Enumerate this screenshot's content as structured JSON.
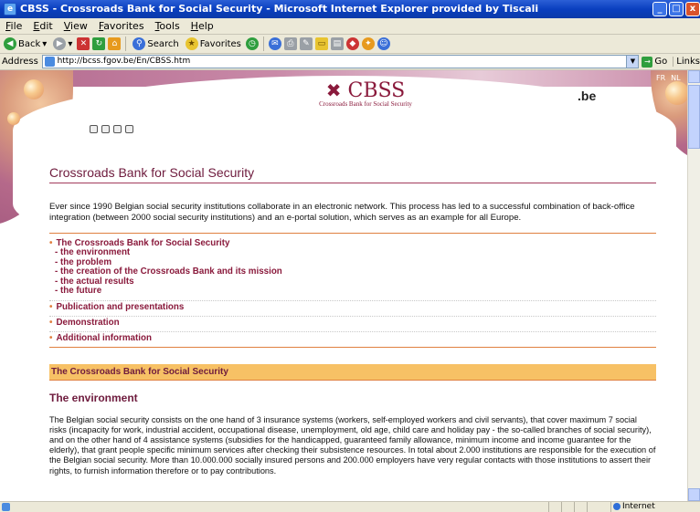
{
  "window": {
    "title": "CBSS - Crossroads Bank for Social Security - Microsoft Internet Explorer provided by Tiscali",
    "buttons": [
      "_",
      "□",
      "x"
    ]
  },
  "menu": [
    "File",
    "Edit",
    "View",
    "Favorites",
    "Tools",
    "Help"
  ],
  "toolbar": {
    "back": "Back",
    "search": "Search",
    "favorites": "Favorites"
  },
  "address": {
    "label": "Address",
    "url": "http://bcss.fgov.be/En/CBSS.htm",
    "go": "Go",
    "links": "Links"
  },
  "header": {
    "logo_text": "CBSS",
    "logo_mark": "✖",
    "tagline": "Crossroads Bank for Social Security",
    "domain_badge": ".be",
    "languages": [
      "FR",
      "NL"
    ],
    "tool_icons": [
      "print-icon",
      "print-icon",
      "search-icon",
      "mail-icon"
    ]
  },
  "page": {
    "title": "Crossroads Bank for Social Security",
    "intro": "Ever since 1990 Belgian social security institutions collaborate in an electronic network. This process has led to a successful combination of back-office integration (between 2000 social security institutions) and an e-portal solution, which serves as an example for all Europe.",
    "nav": [
      {
        "label": "The Crossroads Bank for Social Security",
        "subs": [
          "- the environment",
          "- the problem",
          "- the creation of the Crossroads Bank and its mission",
          "- the actual results",
          "- the future"
        ]
      },
      {
        "label": "Publication and presentations",
        "subs": []
      },
      {
        "label": "Demonstration",
        "subs": []
      },
      {
        "label": "Additional information",
        "subs": []
      }
    ],
    "section_heading": "The Crossroads Bank for Social Security",
    "subheading": "The environment",
    "body": "The Belgian social security consists on the one hand of 3 insurance systems (workers, self-employed workers and civil servants), that cover maximum 7 social risks (incapacity for work, industrial accident, occupational disease, unemployment, old age, child care and holiday pay - the so-called branches of social security), and on the other hand of 4 assistance systems (subsidies for the handicapped, guaranteed family allowance, minimum income and income guarantee for the elderly), that grant people specific minimum services after checking their subsistence resources. In total about 2.000 institutions are responsible for the execution of the Belgian social security. More than 10.000.000 socially insured persons and 200.000 employers have very regular contacts with those institutions to assert their rights, to furnish information therefore or to pay contributions."
  },
  "status": {
    "zone": "Internet"
  }
}
